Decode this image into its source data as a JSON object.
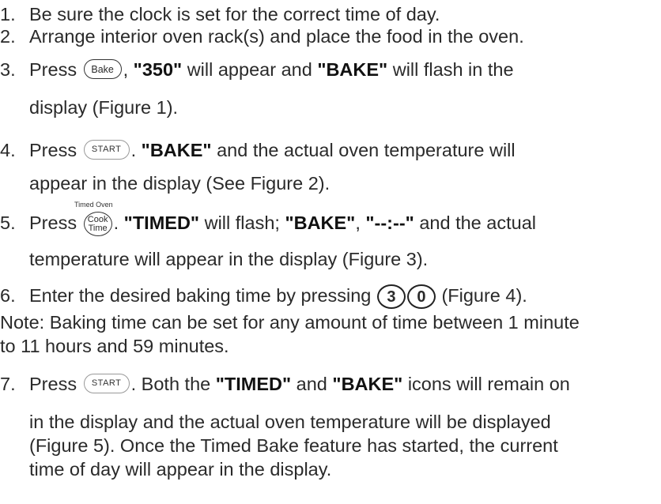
{
  "steps": [
    {
      "num": "1.",
      "text": "Be sure the clock is set for the correct time of day."
    },
    {
      "num": "2.",
      "text": "Arrange interior oven rack(s) and place the food in the oven."
    },
    {
      "num": "3.",
      "press": "Press",
      "bake_btn": "Bake",
      "comma": ", ",
      "val": "\"350\"",
      "mid": " will appear and ",
      "bake": "\"BAKE\"",
      "tail": " will flash in the",
      "cont": "display (Figure 1)."
    },
    {
      "num": "4.",
      "press": "Press",
      "start_btn": "START",
      "dot": ". ",
      "bake": "\"BAKE\"",
      "tail": " and the actual oven temperature will",
      "cont": "appear in the display (See Figure 2)."
    },
    {
      "num": "5.",
      "caption": "Timed Oven",
      "press": "Press",
      "cook_l1": "Cook",
      "cook_l2": "Time",
      "dot": ". ",
      "timed": "\"TIMED\"",
      "mid": " will flash; ",
      "bake": "\"BAKE\"",
      "comma": ", ",
      "dashes": "\"--:--\"",
      "tail": " and the actual",
      "cont": "temperature will appear in the display (Figure 3)."
    },
    {
      "num": "6.",
      "text": "Enter the desired baking time by pressing",
      "key1": "3",
      "key2": "0",
      "tail": "(Figure 4)."
    },
    {
      "num": "7.",
      "press": "Press",
      "start_btn": "START",
      "mid": ". Both the ",
      "timed": "\"TIMED\"",
      "and": " and ",
      "bake": "\"BAKE\"",
      "tail": " icons will remain on",
      "cont1": "in the display and the actual oven temperature will be displayed",
      "cont2": "(Figure 5). Once the Timed Bake feature has started, the current",
      "cont3": "time of day will appear in the display."
    }
  ],
  "note": {
    "line1": "Note: Baking time can be set for any amount of time between 1 minute",
    "line2": "to 11 hours and 59 minutes."
  }
}
